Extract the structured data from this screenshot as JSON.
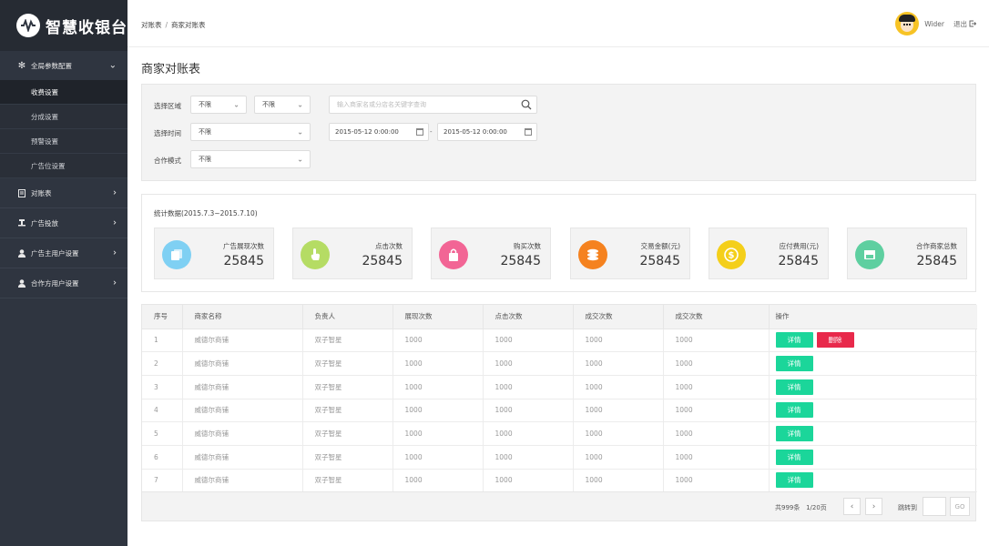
{
  "brand": {
    "name": "智慧收银台"
  },
  "sidebar": {
    "groups": [
      {
        "label": "全局参数配置",
        "icon": "gear-icon",
        "open": true
      },
      {
        "label": "对账表",
        "icon": "document-icon"
      },
      {
        "label": "广告投放",
        "icon": "pin-icon"
      },
      {
        "label": "广告主用户设置",
        "icon": "user-icon"
      },
      {
        "label": "合作方用户设置",
        "icon": "user-icon"
      }
    ],
    "sub_items": [
      "收费设置",
      "分成设置",
      "预警设置",
      "广告位设置"
    ],
    "active_sub": "收费设置"
  },
  "header": {
    "breadcrumb": [
      "对账表",
      "商家对账表"
    ],
    "user_name": "Wider",
    "logout_label": "退出"
  },
  "page": {
    "title": "商家对账表"
  },
  "filter": {
    "region_label": "选择区域",
    "region_1": "不限",
    "region_2": "不限",
    "search_placeholder": "输入商家名或分店名关键字查询",
    "time_label": "选择时间",
    "time_value": "不限",
    "date_from": "2015-05-12 0:00:00",
    "date_to": "2015-05-12 0:00:00",
    "date_sep": "-",
    "mode_label": "合作模式",
    "mode_value": "不限"
  },
  "stats": {
    "title": "统计数据(2015.7.3~2015.7.10)",
    "cards": [
      {
        "label": "广告展现次数",
        "value": "25845",
        "color": "#7fd0f3",
        "icon": "copy-icon"
      },
      {
        "label": "点击次数",
        "value": "25845",
        "color": "#b5dc64",
        "icon": "hand-pointer-icon"
      },
      {
        "label": "购买次数",
        "value": "25845",
        "color": "#f26595",
        "icon": "shopping-bag-icon"
      },
      {
        "label": "交易金额(元)",
        "value": "25845",
        "color": "#f5821f",
        "icon": "coins-icon"
      },
      {
        "label": "应付费用(元)",
        "value": "25845",
        "color": "#f4cf1a",
        "icon": "dollar-coin-icon"
      },
      {
        "label": "合作商家总数",
        "value": "25845",
        "color": "#5ecfa0",
        "icon": "store-icon"
      }
    ]
  },
  "table": {
    "headers": [
      "序号",
      "商家名称",
      "负责人",
      "展现次数",
      "点击次数",
      "成交次数",
      "成交次数",
      "操作"
    ],
    "rows": [
      [
        "1",
        "威德尔商铺",
        "双子智星",
        "1000",
        "1000",
        "1000",
        "1000"
      ],
      [
        "2",
        "威德尔商铺",
        "双子智星",
        "1000",
        "1000",
        "1000",
        "1000"
      ],
      [
        "3",
        "威德尔商铺",
        "双子智星",
        "1000",
        "1000",
        "1000",
        "1000"
      ],
      [
        "4",
        "威德尔商铺",
        "双子智星",
        "1000",
        "1000",
        "1000",
        "1000"
      ],
      [
        "5",
        "威德尔商铺",
        "双子智星",
        "1000",
        "1000",
        "1000",
        "1000"
      ],
      [
        "6",
        "威德尔商铺",
        "双子智星",
        "1000",
        "1000",
        "1000",
        "1000"
      ],
      [
        "7",
        "威德尔商铺",
        "双子智星",
        "1000",
        "1000",
        "1000",
        "1000"
      ]
    ],
    "detail_label": "详情",
    "delete_label": "删除"
  },
  "pager": {
    "total": "共999条",
    "page": "1/20页",
    "jump_label": "跳转到",
    "go_label": "GO"
  },
  "colors": {
    "sidebar_bg": "#2f3540",
    "green": "#1bd69a",
    "red": "#e8294b"
  }
}
